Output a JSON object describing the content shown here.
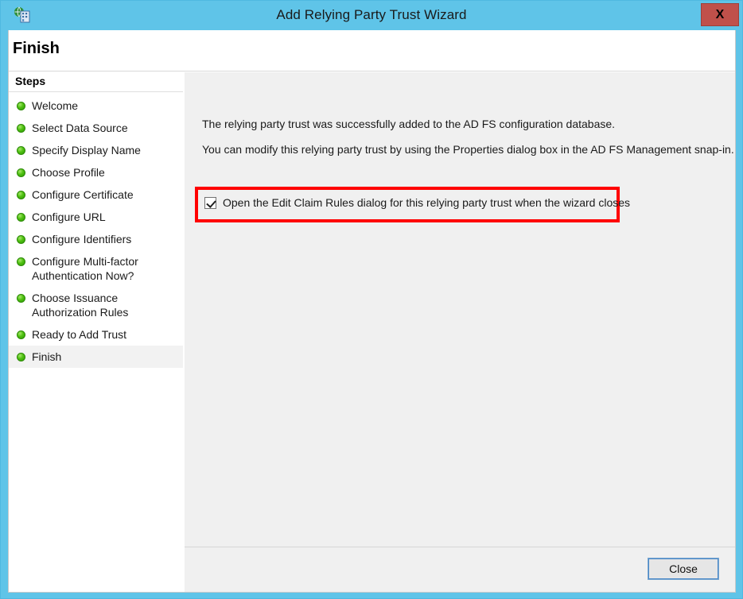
{
  "window": {
    "title": "Add Relying Party Trust Wizard",
    "icon": "adfs-relying-party-icon",
    "close_label": "X",
    "titlebar_color": "#5FC4E8",
    "close_button_color": "#C0504A"
  },
  "header": {
    "page_title": "Finish"
  },
  "sidebar": {
    "header_label": "Steps",
    "items": [
      {
        "label": "Welcome",
        "state": "complete"
      },
      {
        "label": "Select Data Source",
        "state": "complete"
      },
      {
        "label": "Specify Display Name",
        "state": "complete"
      },
      {
        "label": "Choose Profile",
        "state": "complete"
      },
      {
        "label": "Configure Certificate",
        "state": "complete"
      },
      {
        "label": "Configure URL",
        "state": "complete"
      },
      {
        "label": "Configure Identifiers",
        "state": "complete"
      },
      {
        "label": "Configure Multi-factor Authentication Now?",
        "state": "complete"
      },
      {
        "label": "Choose Issuance Authorization Rules",
        "state": "complete"
      },
      {
        "label": "Ready to Add Trust",
        "state": "complete"
      },
      {
        "label": "Finish",
        "state": "current"
      }
    ]
  },
  "main": {
    "paragraph_1": "The relying party trust was successfully added to the AD FS configuration database.",
    "paragraph_2": "You can modify this relying party trust by using the Properties dialog box in the AD FS Management snap-in.",
    "checkbox": {
      "label": "Open the Edit Claim Rules dialog for this relying party trust when the wizard closes",
      "checked": true
    },
    "highlight_color": "#FF0000"
  },
  "footer": {
    "close_label": "Close"
  }
}
